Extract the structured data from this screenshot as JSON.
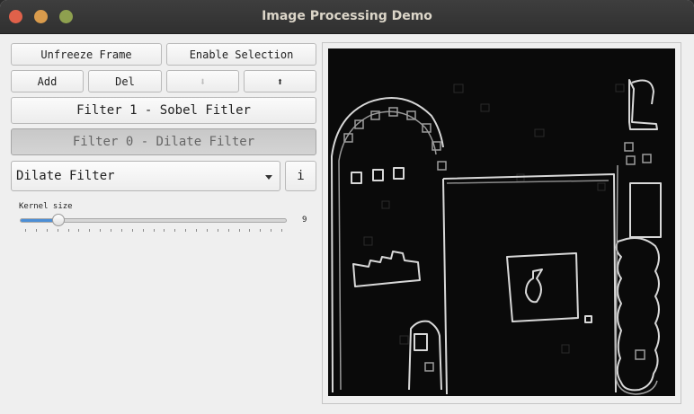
{
  "window": {
    "title": "Image Processing Demo"
  },
  "toolbar": {
    "unfreeze_label": "Unfreeze Frame",
    "enable_selection_label": "Enable Selection",
    "add_label": "Add",
    "del_label": "Del",
    "move_down_icon": "⬇",
    "move_up_icon": "⬆"
  },
  "filters": [
    {
      "label": "Filter 1 - Sobel Fitler",
      "selected": false
    },
    {
      "label": "Filter 0 - Dilate Filter",
      "selected": true
    }
  ],
  "filter_select": {
    "value": "Dilate Filter"
  },
  "info_button": {
    "label": "i"
  },
  "kernel": {
    "label": "Kernel size",
    "value": "9",
    "fraction": 0.146
  },
  "colors": {
    "accent": "#4b8ed6",
    "image_bg": "#0a0a0a"
  }
}
